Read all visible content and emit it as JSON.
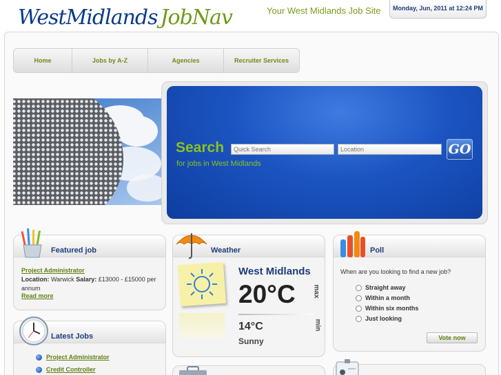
{
  "header": {
    "logo_part1": "WestMidlands",
    "logo_part2": "JobNav",
    "tagline": "Your West Midlands Job Site",
    "date": "Monday, Jun, 2011 at 12:24 PM"
  },
  "nav": {
    "items": [
      {
        "label": "Home"
      },
      {
        "label": "Jobs by A-Z"
      },
      {
        "label": "Agencies"
      },
      {
        "label": "Recruiter Services"
      }
    ]
  },
  "search": {
    "title": "Search",
    "subtitle": "for jobs in West Midlands",
    "quick_placeholder": "Quick Search",
    "location_placeholder": "Location",
    "go_label": "GO"
  },
  "featured": {
    "title": "Featured job",
    "job_title": "Project Administrator",
    "location_label": "Location:",
    "location_value": "Warwick",
    "salary_label": "Salary:",
    "salary_value": "£13000 - £15000 per annum",
    "read_more": "Read more"
  },
  "weather": {
    "title": "Weather",
    "region": "West Midlands",
    "max_temp": "20°C",
    "max_label": "max",
    "min_temp": "14°C",
    "min_label": "min",
    "condition": "Sunny"
  },
  "poll": {
    "title": "Poll",
    "question": "When are you looking to find a new job?",
    "options": [
      {
        "label": "Straight away"
      },
      {
        "label": "Within a month"
      },
      {
        "label": "Within six months"
      },
      {
        "label": "Just looking"
      }
    ],
    "vote_label": "Vote now"
  },
  "latest": {
    "title": "Latest Jobs",
    "jobs": [
      {
        "label": "Project Administrator"
      },
      {
        "label": "Credit Controller"
      }
    ]
  },
  "colors": {
    "brand_blue": "#1d3d7c",
    "brand_green": "#8cc21f",
    "link_green": "#5f7f12"
  }
}
